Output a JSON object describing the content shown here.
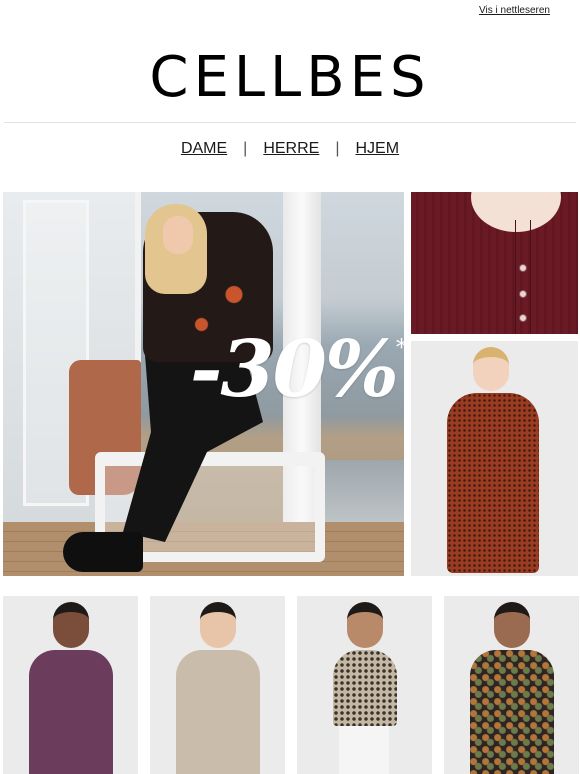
{
  "header": {
    "browser_link": "Vis i nettleseren",
    "logo": "CELLBES"
  },
  "nav": {
    "items": [
      {
        "label": "DAME"
      },
      {
        "label": "HERRE"
      },
      {
        "label": "HJEM"
      }
    ],
    "separator": "|"
  },
  "hero": {
    "promo": "-30%",
    "promo_footnote": "**"
  },
  "colors": {
    "background": "#ffffff",
    "text": "#1a1a1a",
    "burgundy": "#6a1a24",
    "rust": "#9a3b22"
  }
}
